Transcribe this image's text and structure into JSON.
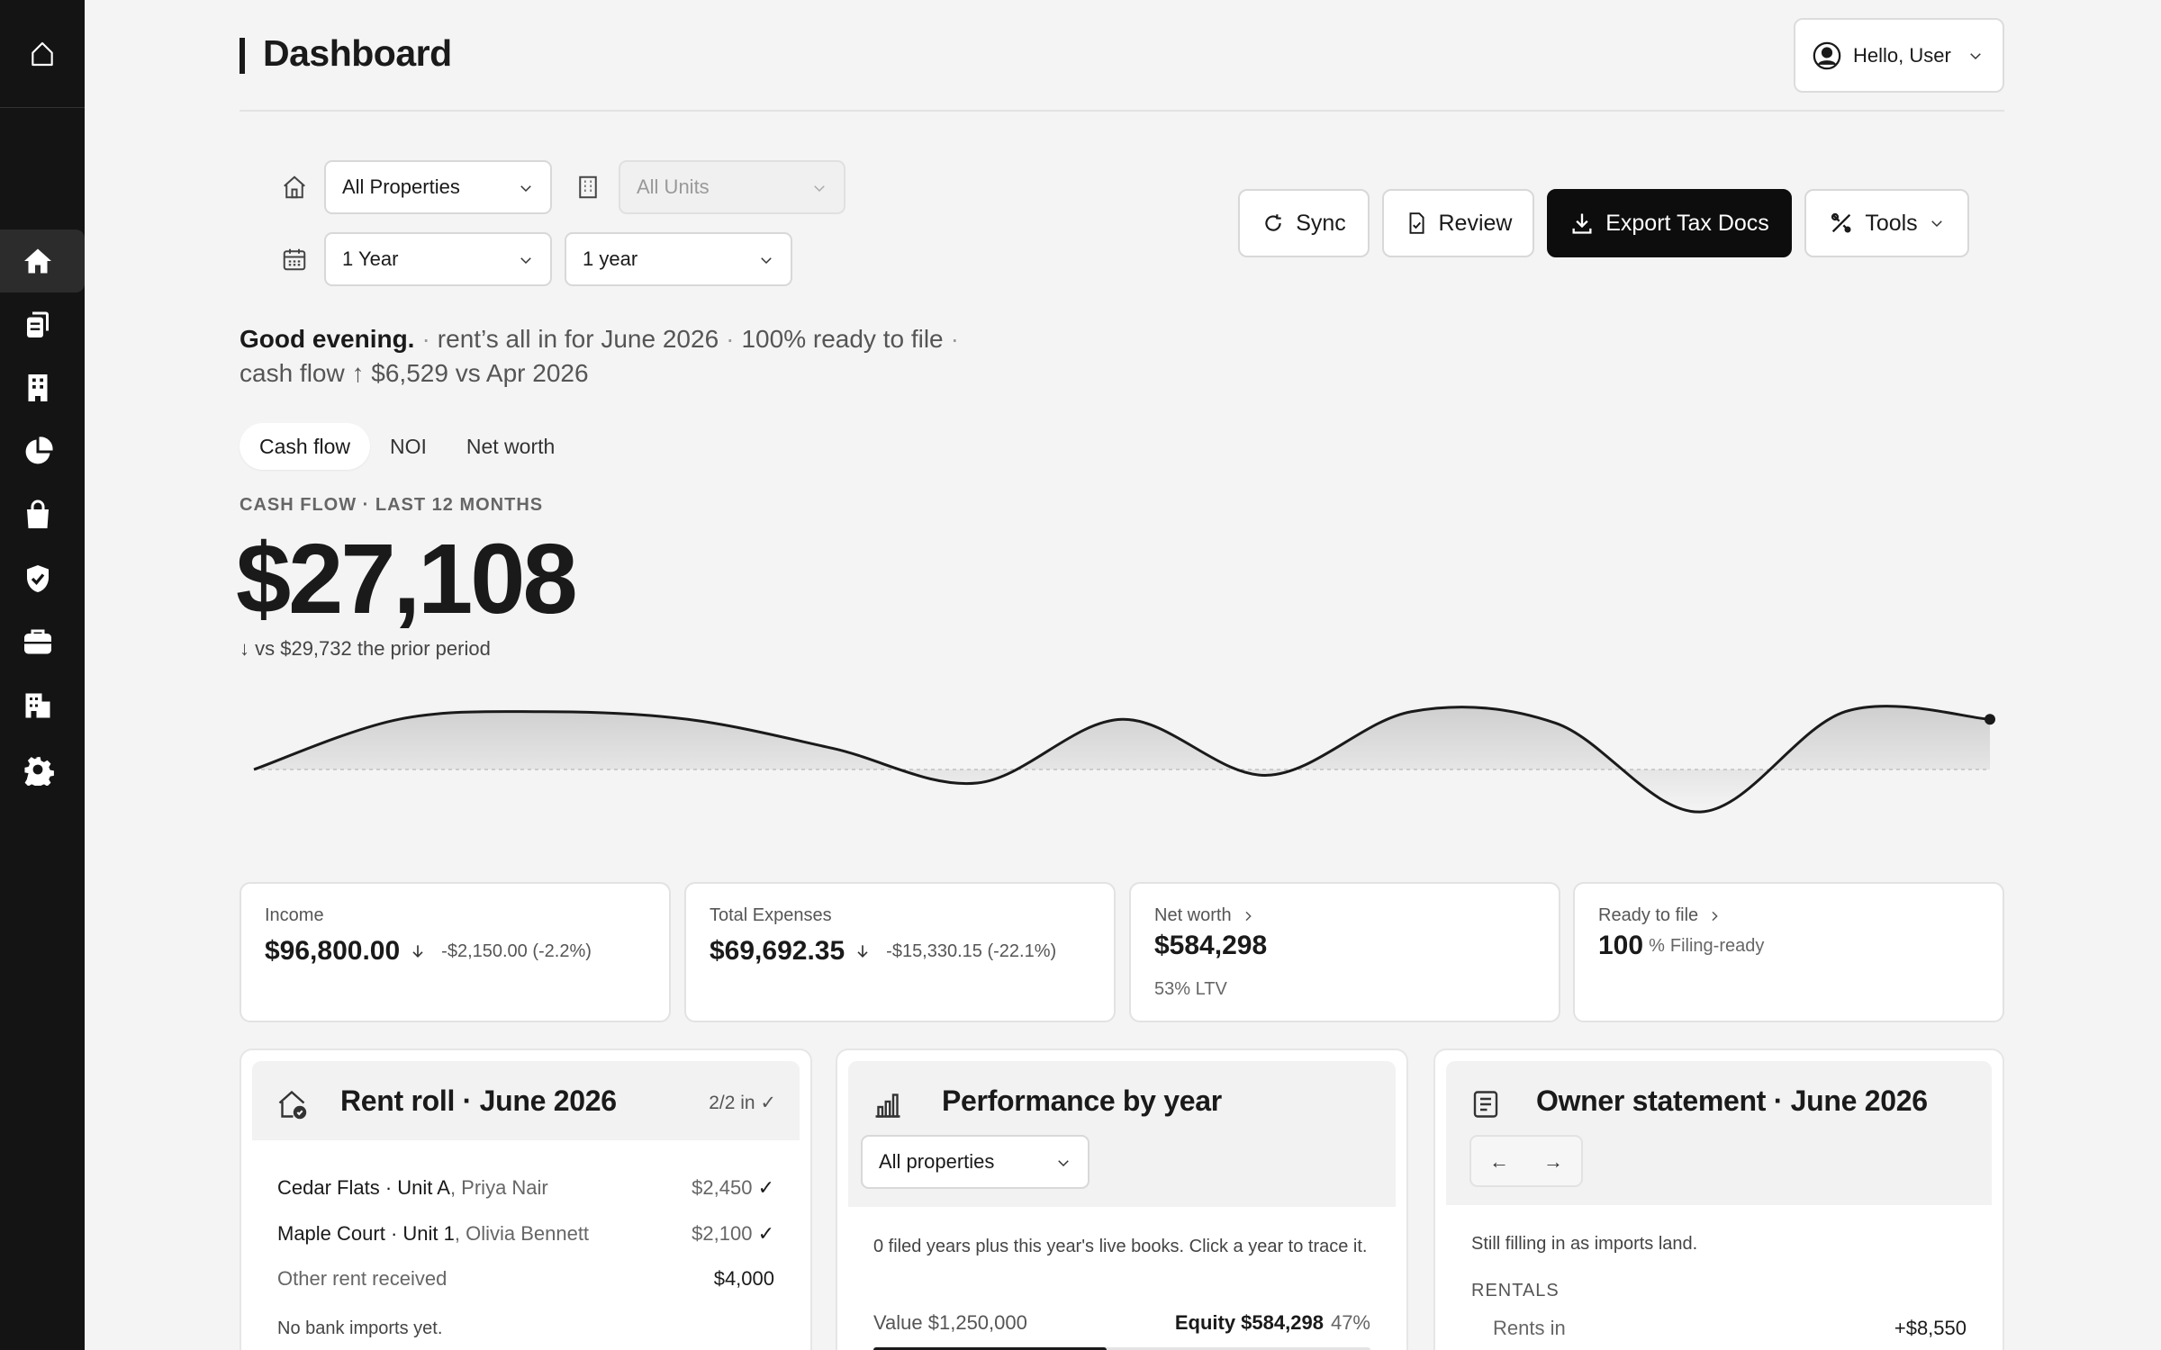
{
  "header": {
    "title": "Dashboard",
    "user_label": "Hello, User"
  },
  "filters": {
    "property": "All Properties",
    "unit": "All Units",
    "period": "1 Year",
    "comparison": "1 year"
  },
  "actions": {
    "sync": "Sync",
    "review": "Review",
    "export": "Export Tax Docs",
    "tools": "Tools"
  },
  "greeting": {
    "hello": "Good evening.",
    "rent": "rent’s all in for June 2026",
    "ready": "100% ready to file",
    "cashflow": "cash flow ↑ $6,529 vs Apr 2026"
  },
  "tabs": [
    "Cash flow",
    "NOI",
    "Net worth"
  ],
  "hero": {
    "kicker": "CASH FLOW · LAST 12 MONTHS",
    "value": "$27,108",
    "compare": "↓ vs $29,732 the prior period"
  },
  "chart_data": {
    "type": "area",
    "values": [
      0,
      2.6,
      3.0,
      2.6,
      1.1,
      -0.7,
      2.6,
      -0.3,
      3.0,
      2.4,
      -2.2,
      3.0,
      2.6
    ],
    "baseline": 0
  },
  "stats": {
    "income": {
      "label": "Income",
      "value": "$96,800.00",
      "delta": "-$2,150.00 (-2.2%)"
    },
    "expenses": {
      "label": "Total Expenses",
      "value": "$69,692.35",
      "delta": "-$15,330.15 (-22.1%)"
    },
    "networth": {
      "label": "Net worth",
      "value": "$584,298",
      "sub": "53% LTV"
    },
    "ready": {
      "label": "Ready to file",
      "value": "100",
      "unit": "%",
      "sub": "Filing-ready"
    }
  },
  "rent_roll": {
    "title": "Rent roll ·  June 2026",
    "badge": "2/2 in ✓",
    "rows": [
      {
        "unit": "Cedar Flats · Unit A",
        "tenant": ", Priya Nair",
        "amount": "$2,450",
        "check": "✓"
      },
      {
        "unit": "Maple Court · Unit 1",
        "tenant": ", Olivia Bennett",
        "amount": "$2,100",
        "check": "✓"
      }
    ],
    "other_label": "Other rent received",
    "other_amount": "$4,000",
    "note": "No bank imports yet."
  },
  "performance": {
    "title": "Performance by year",
    "select": "All properties",
    "desc": "0 filed years plus this year's live books. Click a year to trace it.",
    "value_label": "Value $1,250,000",
    "equity_label": "Equity $584,298",
    "equity_pct": "47%",
    "equity_fraction": 0.47
  },
  "owner_statement": {
    "title": "Owner statement ·  June 2026",
    "prev": "←",
    "next": "→",
    "note": "Still filling in as imports land.",
    "section": "RENTALS",
    "rents_label": "Rents in",
    "rents_value": "+$8,550"
  }
}
